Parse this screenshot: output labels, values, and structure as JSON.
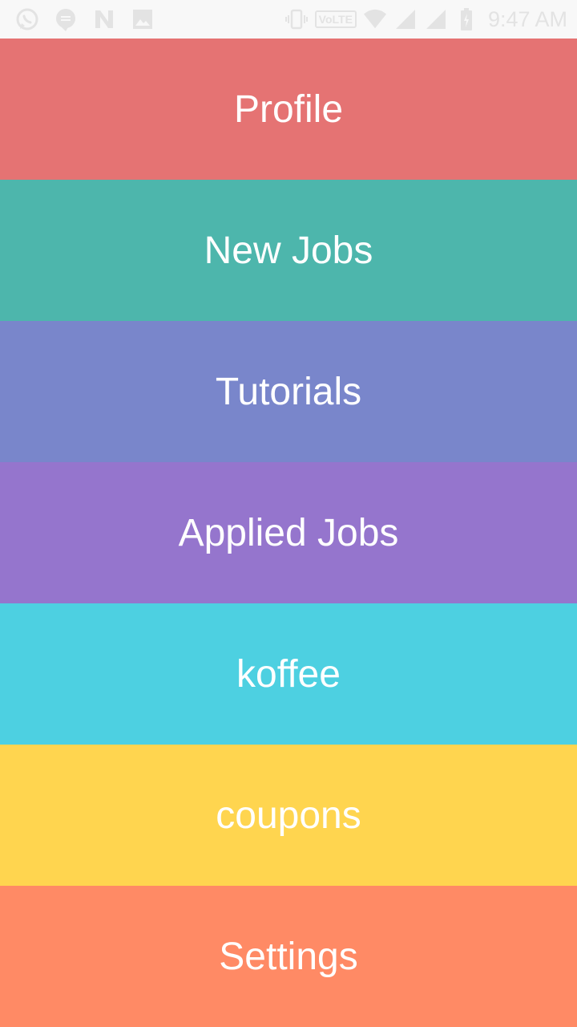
{
  "status_bar": {
    "time": "9:47 AM",
    "network_badge": "VoLTE",
    "left_icons": [
      "whatsapp-icon",
      "chat-icon",
      "notification-n-icon",
      "image-icon"
    ],
    "right_icons": [
      "vibrate-icon",
      "volte-icon",
      "wifi-icon",
      "signal-icon",
      "signal-icon",
      "battery-icon"
    ]
  },
  "menu": {
    "items": [
      {
        "label": "Profile",
        "color": "#e57373"
      },
      {
        "label": "New Jobs",
        "color": "#4db6ac"
      },
      {
        "label": "Tutorials",
        "color": "#7986cb"
      },
      {
        "label": "Applied Jobs",
        "color": "#9575cd"
      },
      {
        "label": "koffee",
        "color": "#4dd0e1"
      },
      {
        "label": "coupons",
        "color": "#ffd54f"
      },
      {
        "label": "Settings",
        "color": "#ff8a65"
      }
    ]
  }
}
